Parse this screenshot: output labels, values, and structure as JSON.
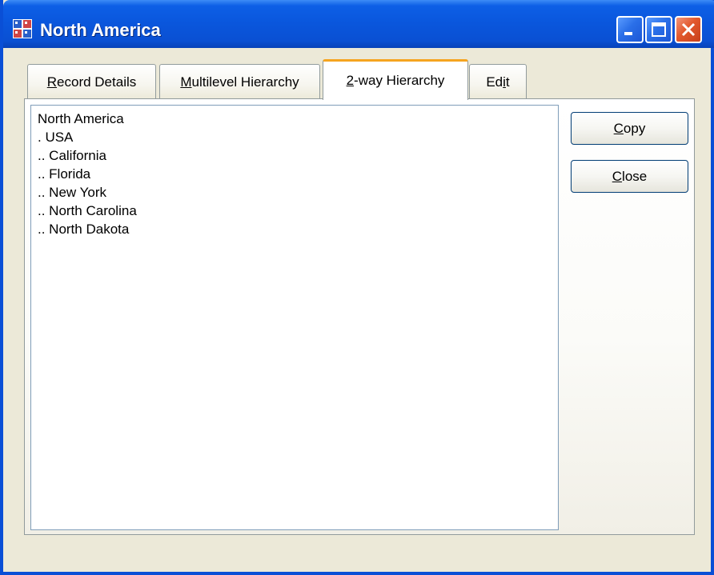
{
  "window": {
    "title": "North America"
  },
  "tabs": [
    {
      "pre": "",
      "ul": "R",
      "post": "ecord Details",
      "active": false
    },
    {
      "pre": "",
      "ul": "M",
      "post": "ultilevel Hierarchy",
      "active": false
    },
    {
      "pre": "",
      "ul": "2",
      "post": "-way Hierarchy",
      "active": true
    },
    {
      "pre": "Ed",
      "ul": "i",
      "post": "t",
      "active": false
    }
  ],
  "hierarchy_list": [
    "North America",
    ". USA",
    ".. California",
    ".. Florida",
    ".. New York",
    ".. North Carolina",
    ".. North Dakota"
  ],
  "buttons": {
    "copy": {
      "ul": "C",
      "post": "opy"
    },
    "close": {
      "ul": "C",
      "post": "lose"
    }
  },
  "colors": {
    "titlebar_blue": "#0a56dc",
    "window_face": "#ece9d8",
    "active_tab_accent": "#f5a41f",
    "close_button_red": "#e2582c"
  },
  "icons": {
    "app_icon": "hierarchy-grid-icon",
    "minimize": "minimize-icon",
    "maximize": "maximize-icon",
    "close": "close-icon"
  }
}
